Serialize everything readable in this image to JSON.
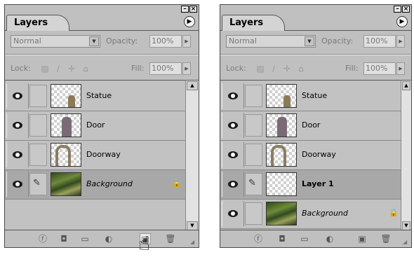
{
  "panels": [
    {
      "id": "left",
      "title": "Layers",
      "blend_mode": "Normal",
      "opacity_label": "Opacity:",
      "opacity_value": "100%",
      "lock_label": "Lock:",
      "fill_label": "Fill:",
      "fill_value": "100%",
      "layers": [
        {
          "name": "Statue",
          "style": "normal",
          "visible": true,
          "thumb": "statue-thumbnail"
        },
        {
          "name": "Door",
          "style": "normal",
          "visible": true,
          "thumb": "door-thumbnail"
        },
        {
          "name": "Doorway",
          "style": "normal",
          "visible": true,
          "thumb": "doorway-thumbnail"
        },
        {
          "name": "Background",
          "style": "italic",
          "visible": true,
          "active": true,
          "locked": true,
          "thumb": "background-thumbnail"
        }
      ]
    },
    {
      "id": "right",
      "title": "Layers",
      "blend_mode": "Normal",
      "opacity_label": "Opacity:",
      "opacity_value": "100%",
      "lock_label": "Lock:",
      "fill_label": "Fill:",
      "fill_value": "100%",
      "layers": [
        {
          "name": "Statue",
          "style": "normal",
          "visible": true,
          "thumb": "statue-thumbnail"
        },
        {
          "name": "Door",
          "style": "normal",
          "visible": true,
          "thumb": "door-thumbnail"
        },
        {
          "name": "Doorway",
          "style": "normal",
          "visible": true,
          "thumb": "doorway-thumbnail"
        },
        {
          "name": "Layer 1",
          "style": "bold",
          "visible": true,
          "active": true,
          "thumb": "empty-layer-thumbnail"
        },
        {
          "name": "Background",
          "style": "italic",
          "visible": true,
          "locked": true,
          "thumb": "background-thumbnail"
        }
      ]
    }
  ],
  "icons": {
    "window_minimize": "minimize-icon",
    "window_close": "close-icon",
    "panel_menu": "panel-menu-arrow-icon",
    "lock_transparent": "lock-transparency-icon",
    "lock_paint": "lock-paint-brush-icon",
    "lock_move": "lock-move-icon",
    "lock_all": "lock-all-icon",
    "eye": "eye-visibility-icon",
    "brush": "paintbrush-icon",
    "layer_lock": "padlock-icon",
    "bottom": [
      "layer-style-icon",
      "add-mask-icon",
      "new-set-folder-icon",
      "adjustment-layer-icon",
      "new-layer-icon",
      "trash-icon"
    ],
    "cursor": "pointing-hand-cursor"
  },
  "colors": {
    "panel_bg": "#c0c0c0",
    "active_row": "#a8a8a8"
  }
}
